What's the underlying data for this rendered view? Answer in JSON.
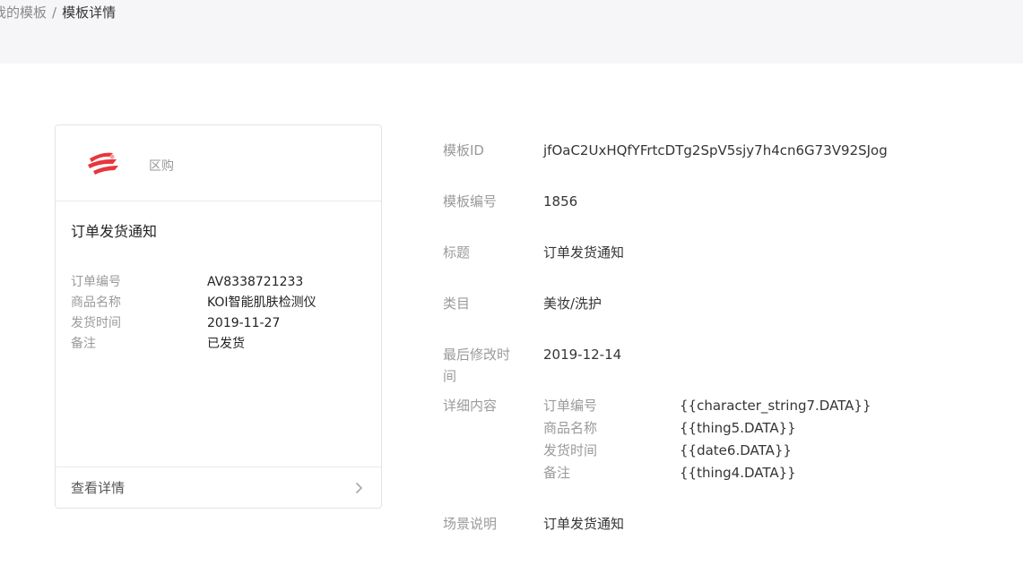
{
  "breadcrumb": {
    "parent": "我的模板",
    "separator": "/",
    "current": "模板详情"
  },
  "preview": {
    "brand_name_hidden": " ",
    "brand_name_visible": "区购",
    "title": "订单发货通知",
    "fields": [
      {
        "label": "订单编号",
        "value": "AV8338721233"
      },
      {
        "label": "商品名称",
        "value": "KOI智能肌肤检测仪"
      },
      {
        "label": "发货时间",
        "value": "2019-11-27"
      },
      {
        "label": "备注",
        "value": "已发货"
      }
    ],
    "footer_label": "查看详情"
  },
  "detail": {
    "template_id_label": "模板ID",
    "template_id": "jfOaC2UxHQfYFrtcDTg2SpV5sjy7h4cn6G73V92SJog",
    "template_no_label": "模板编号",
    "template_no": "1856",
    "title_label": "标题",
    "title": "订单发货通知",
    "category_label": "类目",
    "category": "美妆/洗护",
    "modified_label": "最后修改时间",
    "modified": "2019-12-14",
    "content_label": "详细内容",
    "content": [
      {
        "label": "订单编号",
        "value": "{{character_string7.DATA}}"
      },
      {
        "label": "商品名称",
        "value": "{{thing5.DATA}}"
      },
      {
        "label": "发货时间",
        "value": "{{date6.DATA}}"
      },
      {
        "label": "备注",
        "value": "{{thing4.DATA}}"
      }
    ],
    "scene_label": "场景说明",
    "scene": "订单发货通知"
  },
  "colors": {
    "topbar_bg": "#f6f6f8",
    "label_gray": "#9a9a9a",
    "logo_red": "#e8363c"
  }
}
